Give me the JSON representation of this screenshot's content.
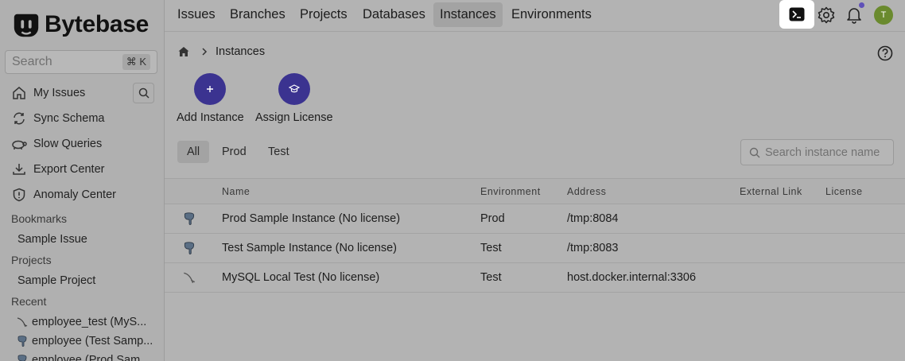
{
  "brand": {
    "name": "Bytebase"
  },
  "search": {
    "placeholder": "Search",
    "shortcut": "⌘ K"
  },
  "sidebar": {
    "items": [
      {
        "label": "My Issues",
        "icon": "home-icon"
      },
      {
        "label": "Sync Schema",
        "icon": "sync-icon"
      },
      {
        "label": "Slow Queries",
        "icon": "turtle-icon"
      },
      {
        "label": "Export Center",
        "icon": "download-icon"
      },
      {
        "label": "Anomaly Center",
        "icon": "shield-alert-icon"
      }
    ],
    "bookmarks_label": "Bookmarks",
    "bookmarks": [
      "Sample Issue"
    ],
    "projects_label": "Projects",
    "projects": [
      "Sample Project"
    ],
    "recent_label": "Recent",
    "recent": [
      {
        "label": "employee_test (MyS...",
        "icon": "mysql-icon"
      },
      {
        "label": "employee (Test Samp...",
        "icon": "postgres-icon"
      },
      {
        "label": "employee (Prod Sam...",
        "icon": "postgres-icon"
      }
    ]
  },
  "topnav": {
    "tabs": [
      "Issues",
      "Branches",
      "Projects",
      "Databases",
      "Instances",
      "Environments"
    ],
    "active": "Instances",
    "avatar_initial": "T"
  },
  "breadcrumb": {
    "current": "Instances"
  },
  "actions": [
    {
      "label": "Add Instance",
      "icon": "plus-icon"
    },
    {
      "label": "Assign License",
      "icon": "graduation-cap-icon"
    }
  ],
  "filters": {
    "tabs": [
      "All",
      "Prod",
      "Test"
    ],
    "active": "All"
  },
  "instance_search": {
    "placeholder": "Search instance name"
  },
  "table": {
    "columns": [
      "Name",
      "Environment",
      "Address",
      "External Link",
      "License"
    ],
    "rows": [
      {
        "engine": "postgres",
        "name": "Prod Sample Instance (No license)",
        "environment": "Prod",
        "address": "/tmp:8084"
      },
      {
        "engine": "postgres",
        "name": "Test Sample Instance (No license)",
        "environment": "Test",
        "address": "/tmp:8083"
      },
      {
        "engine": "mysql",
        "name": "MySQL Local Test (No license)",
        "environment": "Test",
        "address": "host.docker.internal:3306"
      }
    ]
  },
  "colors": {
    "accent": "#3b3390",
    "avatar": "#6a8a2e",
    "notification_dot": "#5f50b8"
  }
}
